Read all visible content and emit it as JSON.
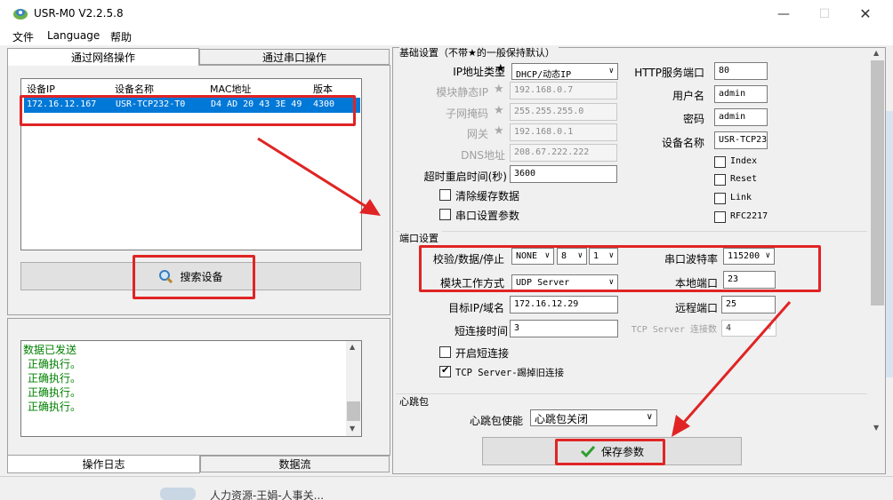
{
  "window": {
    "title": "USR-M0 V2.2.5.8"
  },
  "menu": {
    "file": "文件",
    "language": "Language",
    "help": "帮助"
  },
  "left": {
    "tab_network": "通过网络操作",
    "tab_serial": "通过串口操作",
    "columns": {
      "ip": "设备IP",
      "name": "设备名称",
      "mac": "MAC地址",
      "version": "版本"
    },
    "device": {
      "ip": "172.16.12.167",
      "name": "USR-TCP232-T0",
      "mac": "D4 AD 20 43 3E 49",
      "version": "4300"
    },
    "search_button": "搜索设备",
    "log_lines": [
      "数据已发送",
      "正确执行。",
      "正确执行。",
      "正确执行。",
      "正确执行。"
    ],
    "tab_log": "操作日志",
    "tab_stream": "数据流"
  },
  "basic": {
    "group": "基础设置（不带★的一般保持默认）",
    "ip_type_label": "IP地址类型",
    "ip_type_value": "DHCP/动态IP",
    "static_ip_label": "模块静态IP",
    "static_ip_value": "192.168.0.7",
    "mask_label": "子网掩码",
    "mask_value": "255.255.255.0",
    "gateway_label": "网关",
    "gateway_value": "192.168.0.1",
    "dns_label": "DNS地址",
    "dns_value": "208.67.222.222",
    "timeout_label": "超时重启时间(秒)",
    "timeout_value": "3600",
    "clear_cache": "清除缓存数据",
    "serial_params": "串口设置参数",
    "http_port_label": "HTTP服务端口",
    "http_port_value": "80",
    "user_label": "用户名",
    "user_value": "admin",
    "pwd_label": "密码",
    "pwd_value": "admin",
    "devname_label": "设备名称",
    "devname_value": "USR-TCP23",
    "index": "Index",
    "reset": "Reset",
    "link": "Link",
    "rfc": "RFC2217"
  },
  "port": {
    "group": "端口设置",
    "parity_label": "校验/数据/停止",
    "parity_value": "NONE",
    "data_value": "8",
    "stop_value": "1",
    "baud_label": "串口波特率",
    "baud_value": "115200",
    "mode_label": "模块工作方式",
    "mode_value": "UDP Server",
    "local_port_label": "本地端口",
    "local_port_value": "23",
    "target_label": "目标IP/域名",
    "target_value": "172.16.12.29",
    "remote_port_label": "远程端口",
    "remote_port_value": "25",
    "short_label": "短连接时间",
    "short_value": "3",
    "tcp_conn_label": "TCP Server 连接数",
    "tcp_conn_value": "4",
    "open_short": "开启短连接",
    "kick_old": "TCP Server-踢掉旧连接"
  },
  "heartbeat": {
    "group": "心跳包",
    "enable_label": "心跳包使能",
    "enable_value": "心跳包关闭"
  },
  "save_button": "保存参数",
  "taskbar_text": "人力资源-王娟-人事关..."
}
